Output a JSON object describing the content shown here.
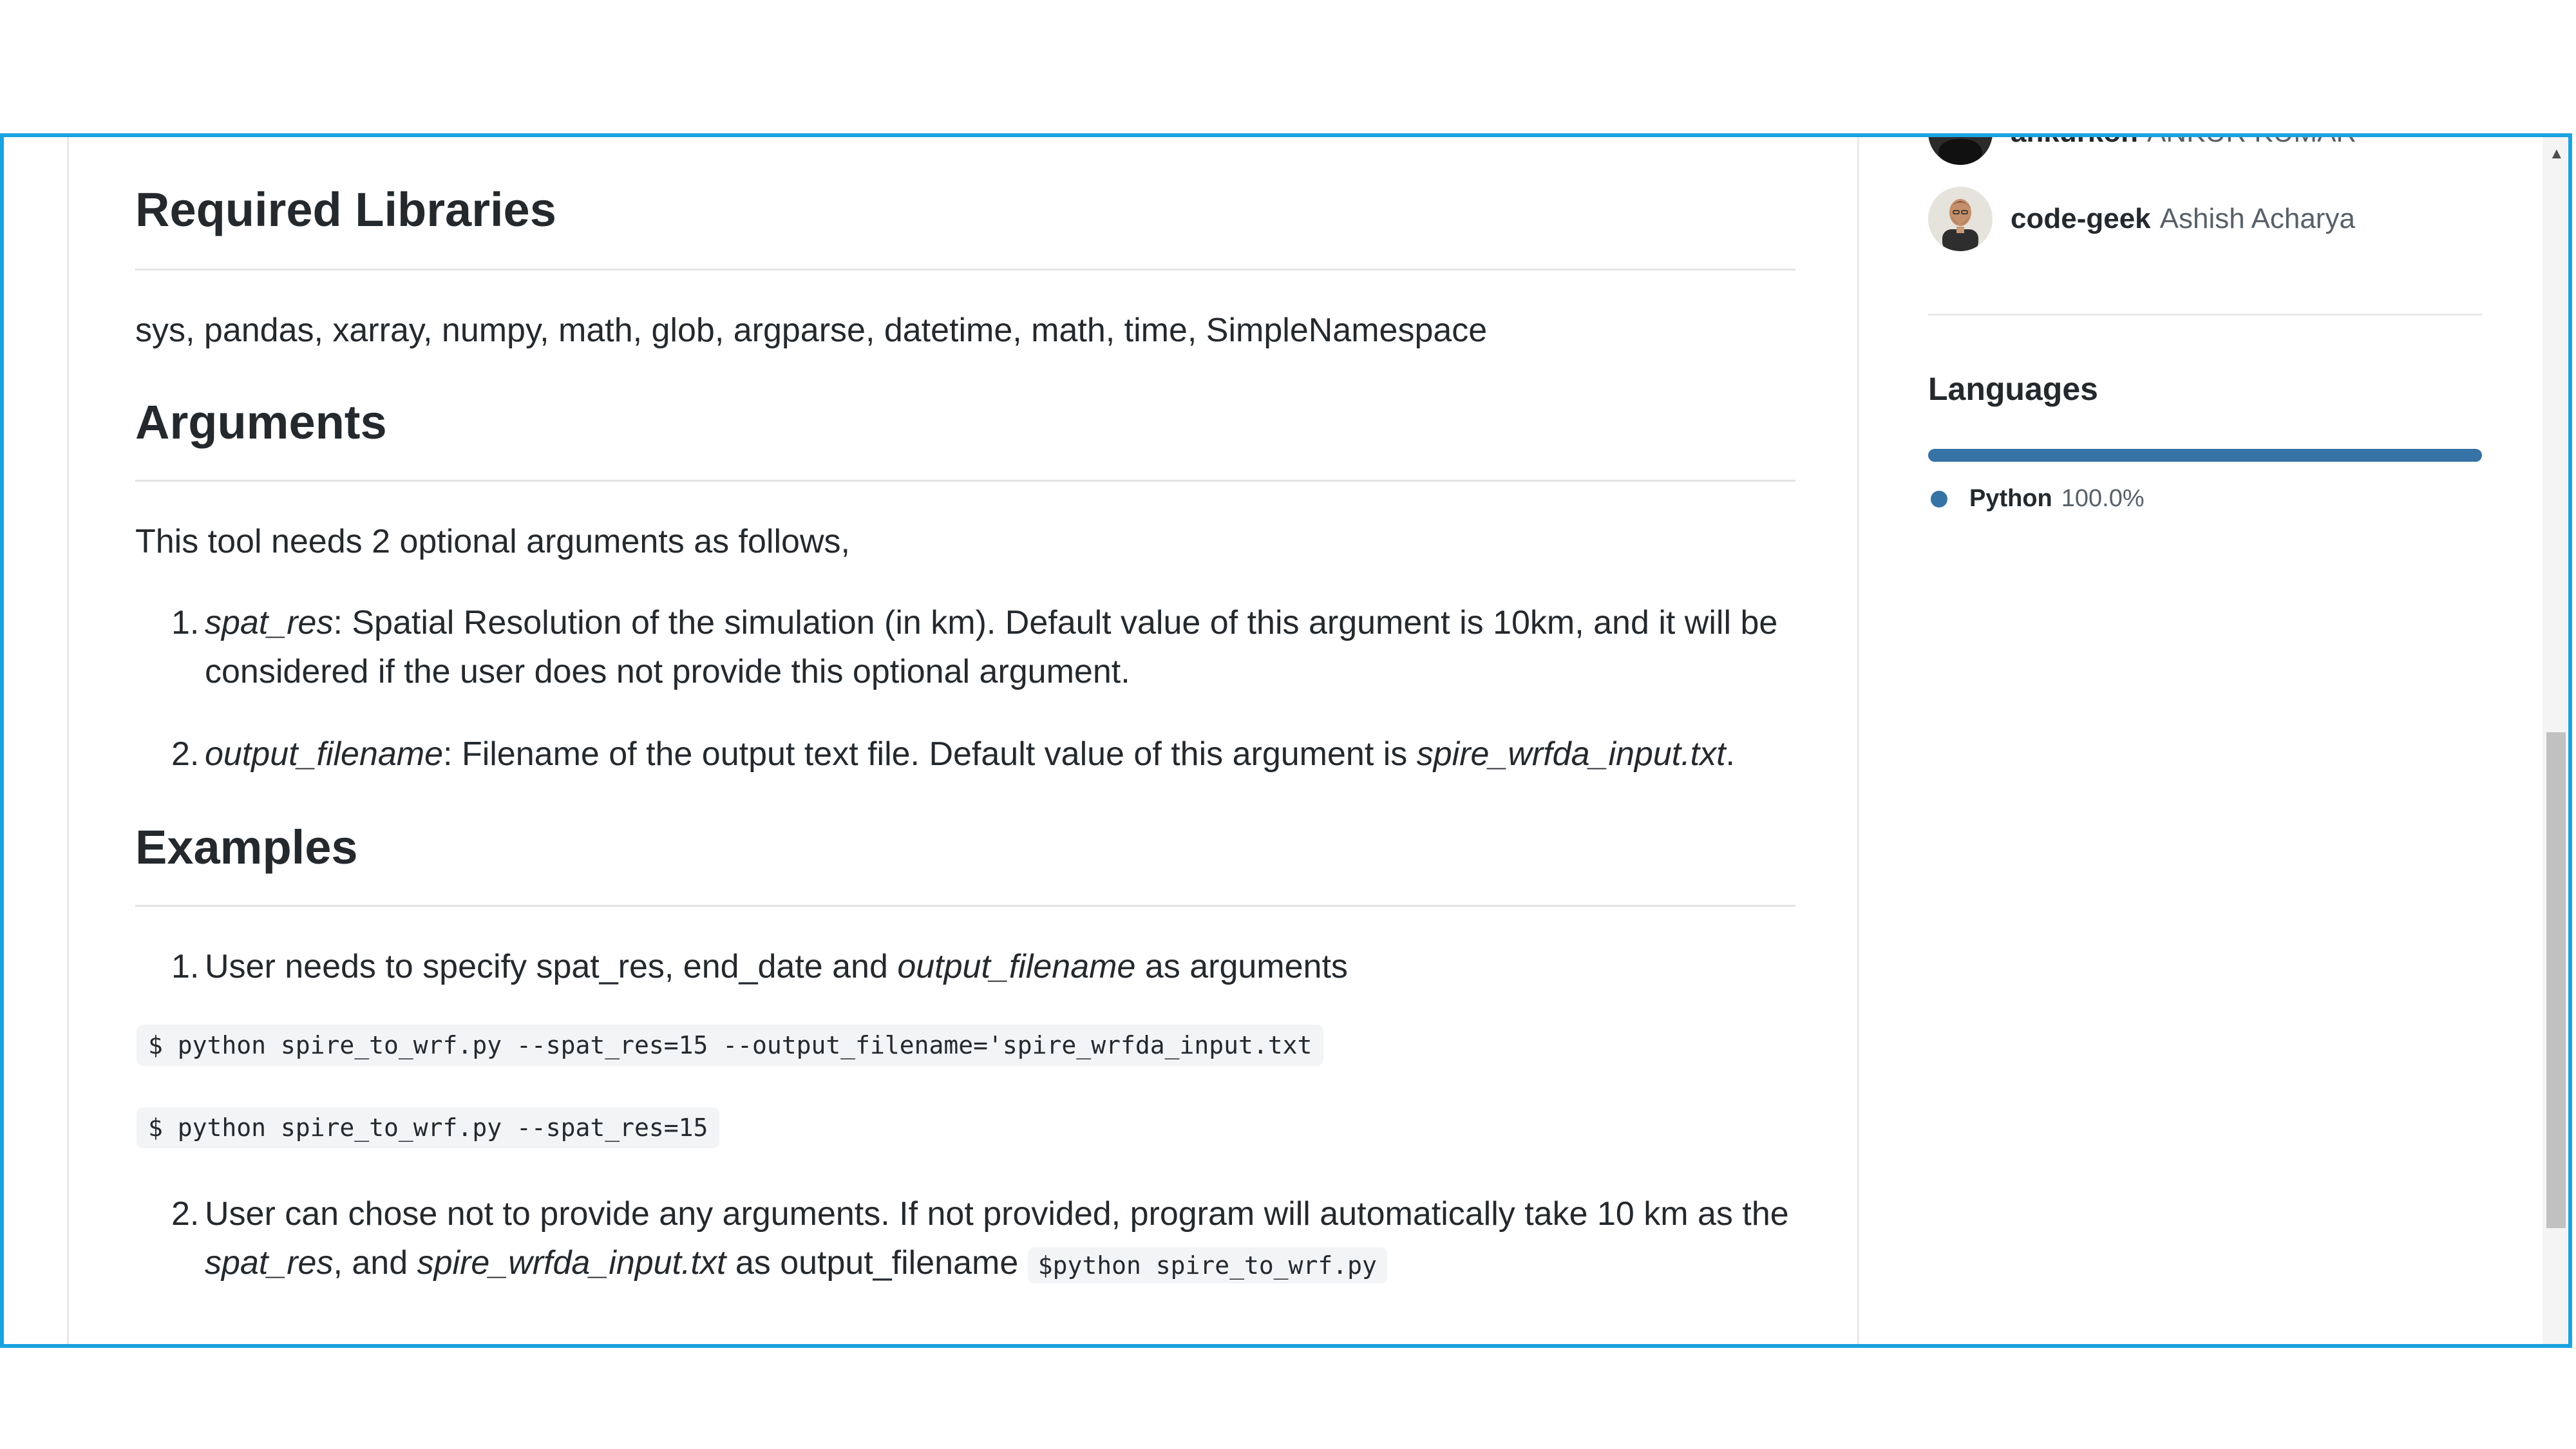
{
  "readme": {
    "sections": {
      "libraries": {
        "heading": "Required Libraries",
        "text": "sys, pandas, xarray, numpy, math, glob, argparse, datetime, math, time, SimpleNamespace"
      },
      "arguments": {
        "heading": "Arguments",
        "intro": "This tool needs 2 optional arguments as follows,",
        "items": [
          {
            "num": "1.",
            "name": "spat_res",
            "text": ": Spatial Resolution of the simulation (in km). Default value of this argument is 10km, and it will be considered if the user does not provide this optional argument."
          },
          {
            "num": "2.",
            "name": "output_filename",
            "text": ": Filename of the output text file. Default value of this argument is ",
            "default": "spire_wrfda_input.txt",
            "end": "."
          }
        ]
      },
      "examples": {
        "heading": "Examples",
        "item1": {
          "num": "1.",
          "text_a": "User needs to specify spat_res, end_date and ",
          "em": "output_filename",
          "text_b": " as arguments"
        },
        "code1": "$ python spire_to_wrf.py --spat_res=15 --output_filename='spire_wrfda_input.txt",
        "code2": "$ python spire_to_wrf.py --spat_res=15",
        "item2": {
          "num": "2.",
          "text_a": "User can chose not to provide any arguments. If not provided, program will automatically take 10 km as the ",
          "em1": "spat_res",
          "text_b": ", and ",
          "em2": "spire_wrfda_input.txt",
          "text_c": " as output_filename ",
          "code": "$python spire_to_wrf.py"
        }
      }
    }
  },
  "sidebar": {
    "contributors": [
      {
        "login": "ankurkoh",
        "name": "ANKUR KUMAR"
      },
      {
        "login": "code-geek",
        "name": "Ashish Acharya"
      }
    ],
    "languages": {
      "title": "Languages",
      "items": [
        {
          "name": "Python",
          "percent": "100.0%",
          "fraction": 1.0,
          "color": "#3572a5"
        }
      ]
    }
  },
  "scrollbar": {
    "up_arrow": "▲"
  }
}
